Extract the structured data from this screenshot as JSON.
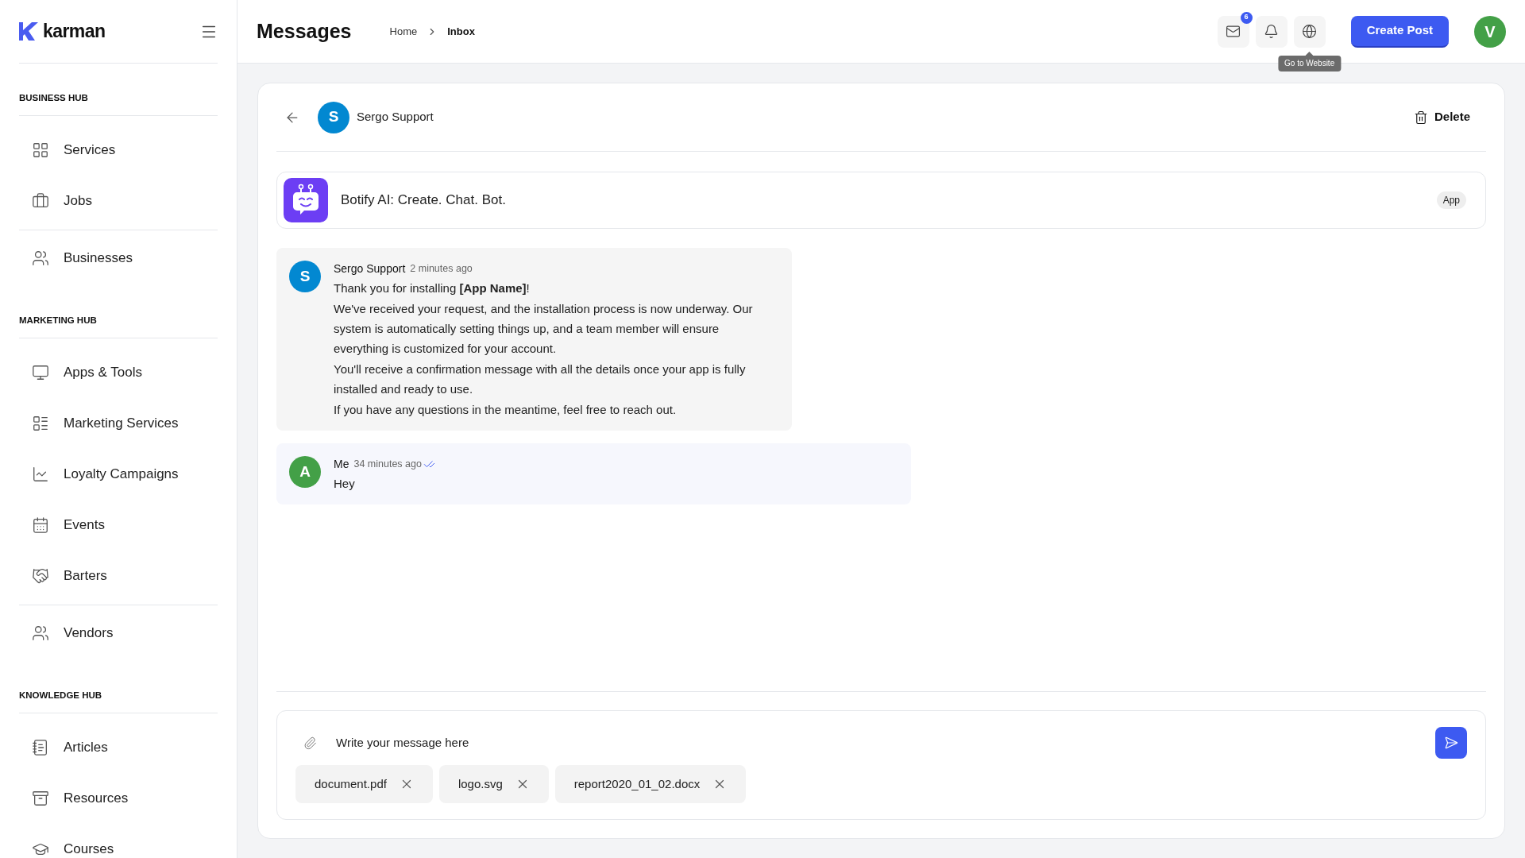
{
  "sidebar": {
    "logo": "karman",
    "sections": [
      {
        "title": "BUSINESS HUB",
        "groups": [
          [
            {
              "label": "Services"
            },
            {
              "label": "Jobs"
            }
          ],
          [
            {
              "label": "Businesses"
            }
          ]
        ]
      },
      {
        "title": "MARKETING HUB",
        "groups": [
          [
            {
              "label": "Apps & Tools"
            },
            {
              "label": "Marketing Services"
            },
            {
              "label": "Loyalty Campaigns"
            },
            {
              "label": "Events"
            },
            {
              "label": "Barters"
            }
          ],
          [
            {
              "label": "Vendors"
            }
          ]
        ]
      },
      {
        "title": "KNOWLEDGE HUB",
        "groups": [
          [
            {
              "label": "Articles"
            },
            {
              "label": "Resources"
            },
            {
              "label": "Courses"
            }
          ]
        ]
      }
    ]
  },
  "header": {
    "title": "Messages",
    "breadcrumb": [
      {
        "label": "Home",
        "current": false
      },
      {
        "label": "Inbox",
        "current": true
      }
    ],
    "mail_badge": "6",
    "tooltip": "Go to Website",
    "create_button": "Create Post",
    "user_avatar": {
      "initial": "V",
      "color": "#43a047"
    }
  },
  "conversation": {
    "contact": {
      "initial": "S",
      "name": "Sergo Support",
      "color": "#0288d1"
    },
    "delete_button": "Delete",
    "app": {
      "name": "Botify AI: Create. Chat. Bot.",
      "badge": "App"
    },
    "messages": [
      {
        "initial": "S",
        "color": "#0288d1",
        "sender": "Sergo Support",
        "time": "2 minutes ago",
        "mine": false,
        "read": false,
        "paragraphs": [
          "Thank you for installing **[App Name]**!",
          "We've received your request, and the installation process is now underway. Our system is automatically setting things up, and a team member will ensure everything is customized for your account.",
          "You'll receive a confirmation message with all the details once your app is fully installed and ready to use.",
          "If you have any questions in the meantime, feel free to reach out."
        ]
      },
      {
        "initial": "A",
        "color": "#43a047",
        "sender": "Me",
        "time": "34 minutes ago",
        "mine": true,
        "read": true,
        "paragraphs": [
          "Hey"
        ]
      }
    ],
    "composer": {
      "placeholder": "Write your message here",
      "attachments": [
        "document.pdf",
        "logo.svg",
        "report2020_01_02.docx"
      ]
    }
  }
}
